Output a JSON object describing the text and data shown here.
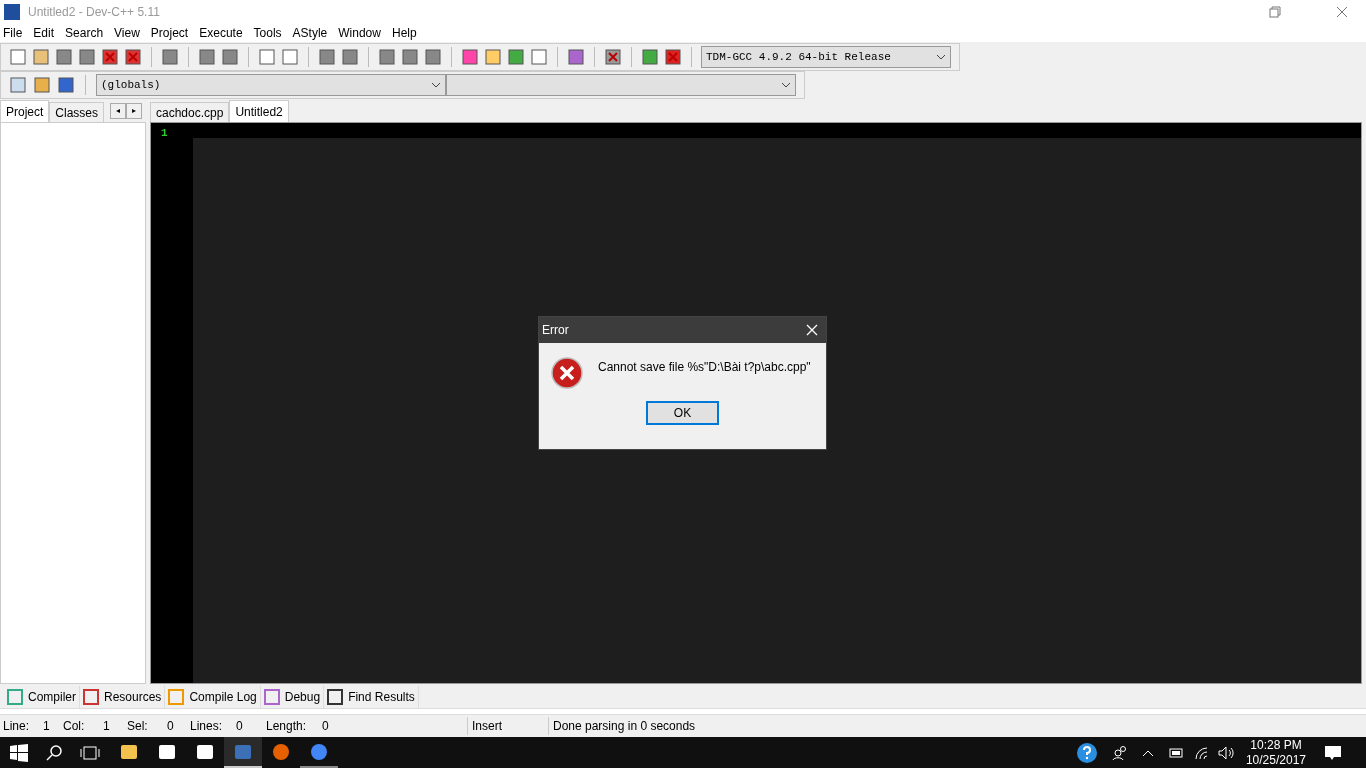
{
  "window": {
    "title": "Untitled2 - Dev-C++ 5.11"
  },
  "menu": [
    "File",
    "Edit",
    "Search",
    "View",
    "Project",
    "Execute",
    "Tools",
    "AStyle",
    "Window",
    "Help"
  ],
  "compiler_select": {
    "value": "TDM-GCC 4.9.2 64-bit Release"
  },
  "scope_select": {
    "value": "(globals)"
  },
  "left_tabs": [
    {
      "label": "Project",
      "selected": true
    },
    {
      "label": "Classes",
      "selected": false
    }
  ],
  "left_tab_scroll": [
    "◂",
    "▸"
  ],
  "editor_tabs": [
    {
      "label": "cachdoc.cpp",
      "selected": false
    },
    {
      "label": "Untitled2",
      "selected": true
    }
  ],
  "editor": {
    "line_numbers": [
      "1"
    ]
  },
  "bottom_tabs": [
    {
      "label": "Compiler",
      "selected": false
    },
    {
      "label": "Resources",
      "selected": false
    },
    {
      "label": "Compile Log",
      "selected": false
    },
    {
      "label": "Debug",
      "selected": false
    },
    {
      "label": "Find Results",
      "selected": false
    }
  ],
  "status_bar": {
    "fields": [
      {
        "label": "Line:",
        "value": "1"
      },
      {
        "label": "Col:",
        "value": "1"
      },
      {
        "label": "Sel:",
        "value": "0"
      },
      {
        "label": "Lines:",
        "value": "0"
      },
      {
        "label": "Length:",
        "value": "0"
      }
    ],
    "mode": "Insert",
    "message": "Done parsing in 0 seconds"
  },
  "dialog": {
    "title": "Error",
    "message": "Cannot save file %s\"D:\\Bài t?p\\abc.cpp\"",
    "button": "OK"
  },
  "taskbar": {
    "apps": [
      {
        "kind": "files",
        "running": false
      },
      {
        "kind": "dropbox",
        "running": false
      },
      {
        "kind": "mail",
        "running": false
      },
      {
        "kind": "devcpp",
        "running": true
      },
      {
        "kind": "firefox",
        "running": false
      },
      {
        "kind": "chrome",
        "running": true
      }
    ],
    "time": "10:28 PM",
    "date": "10/25/2017"
  }
}
